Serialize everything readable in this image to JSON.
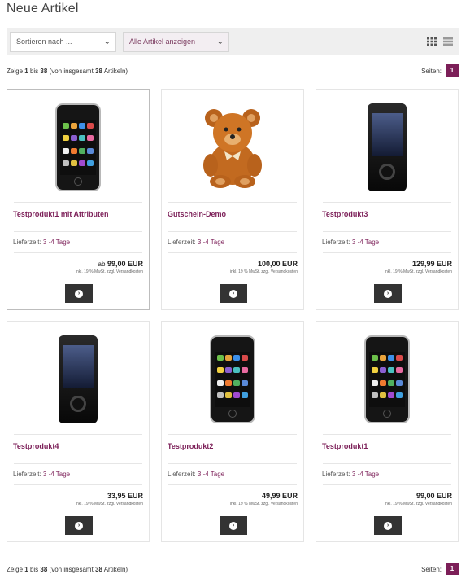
{
  "page": {
    "title": "Neue Artikel"
  },
  "toolbar": {
    "sort_label": "Sortieren nach ...",
    "filter_label": "Alle Artikel anzeigen",
    "grid_view_icon": "grid-view-icon",
    "list_view_icon": "list-view-icon",
    "filter_color": "#7a3b5f"
  },
  "pagination": {
    "prefix": "Zeige",
    "from": "1",
    "to_word": "bis",
    "to": "38",
    "total_prefix": "(von insgesamt",
    "total": "38",
    "total_suffix": "Artikeln)",
    "pages_label": "Seiten:",
    "current_page": "1",
    "accent": "#7c1f58"
  },
  "products": [
    {
      "name": "Testprodukt1 mit Attributen",
      "delivery_label": "Lieferzeit:",
      "delivery_days": "3 -4 Tage",
      "price_prefix": "ab",
      "price": "99,00 EUR",
      "tax_text": "inkl. 19 % MwSt. zzgl.",
      "shipping_link": "Versandkosten",
      "image": "smartphone"
    },
    {
      "name": "Gutschein-Demo",
      "delivery_label": "Lieferzeit:",
      "delivery_days": "3 -4 Tage",
      "price_prefix": "",
      "price": "100,00 EUR",
      "tax_text": "inkl. 19 % MwSt. zzgl.",
      "shipping_link": "Versandkosten",
      "image": "teddy-bear"
    },
    {
      "name": "Testprodukt3",
      "delivery_label": "Lieferzeit:",
      "delivery_days": "3 -4 Tage",
      "price_prefix": "",
      "price": "129,99 EUR",
      "tax_text": "inkl. 19 % MwSt. zzgl.",
      "shipping_link": "Versandkosten",
      "image": "slider-phone"
    },
    {
      "name": "Testprodukt4",
      "delivery_label": "Lieferzeit:",
      "delivery_days": "3 -4 Tage",
      "price_prefix": "",
      "price": "33,95 EUR",
      "tax_text": "inkl. 19 % MwSt. zzgl.",
      "shipping_link": "Versandkosten",
      "image": "slider-phone"
    },
    {
      "name": "Testprodukt2",
      "delivery_label": "Lieferzeit:",
      "delivery_days": "3 -4 Tage",
      "price_prefix": "",
      "price": "49,99 EUR",
      "tax_text": "inkl. 19 % MwSt. zzgl.",
      "shipping_link": "Versandkosten",
      "image": "smartphone"
    },
    {
      "name": "Testprodukt1",
      "delivery_label": "Lieferzeit:",
      "delivery_days": "3 -4 Tage",
      "price_prefix": "",
      "price": "99,00 EUR",
      "tax_text": "inkl. 19 % MwSt. zzgl.",
      "shipping_link": "Versandkosten",
      "image": "smartphone"
    }
  ],
  "cart_button_icon": "chevron-right-icon"
}
